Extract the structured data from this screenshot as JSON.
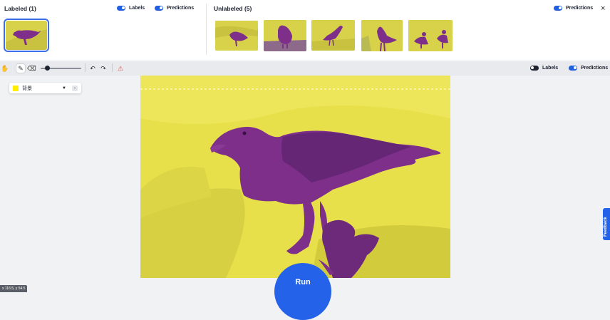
{
  "gallery": {
    "labeled_title": "Labeled (1)",
    "unlabeled_title": "Unlabeled (5)",
    "labels_toggle": "Labels",
    "predictions_toggle": "Predictions",
    "predictions_toggle_right": "Predictions",
    "close_icon": "×"
  },
  "toolbar": {
    "labels_toggle": "Labels",
    "predictions_toggle": "Predictions",
    "icons": [
      "hand-icon",
      "pencil-icon",
      "eraser-icon",
      "undo-icon",
      "redo-icon",
      "clear-icon"
    ]
  },
  "class_picker": {
    "selected": "背景",
    "color": "#ffee00"
  },
  "run_button": "Run",
  "feedback_tab": "Feedback",
  "coords_readout": "x 116.5, y 54.5",
  "colors": {
    "accent": "#2462ea",
    "mask_background": "#d8d24a",
    "mask_bird": "#7d2f8a"
  }
}
